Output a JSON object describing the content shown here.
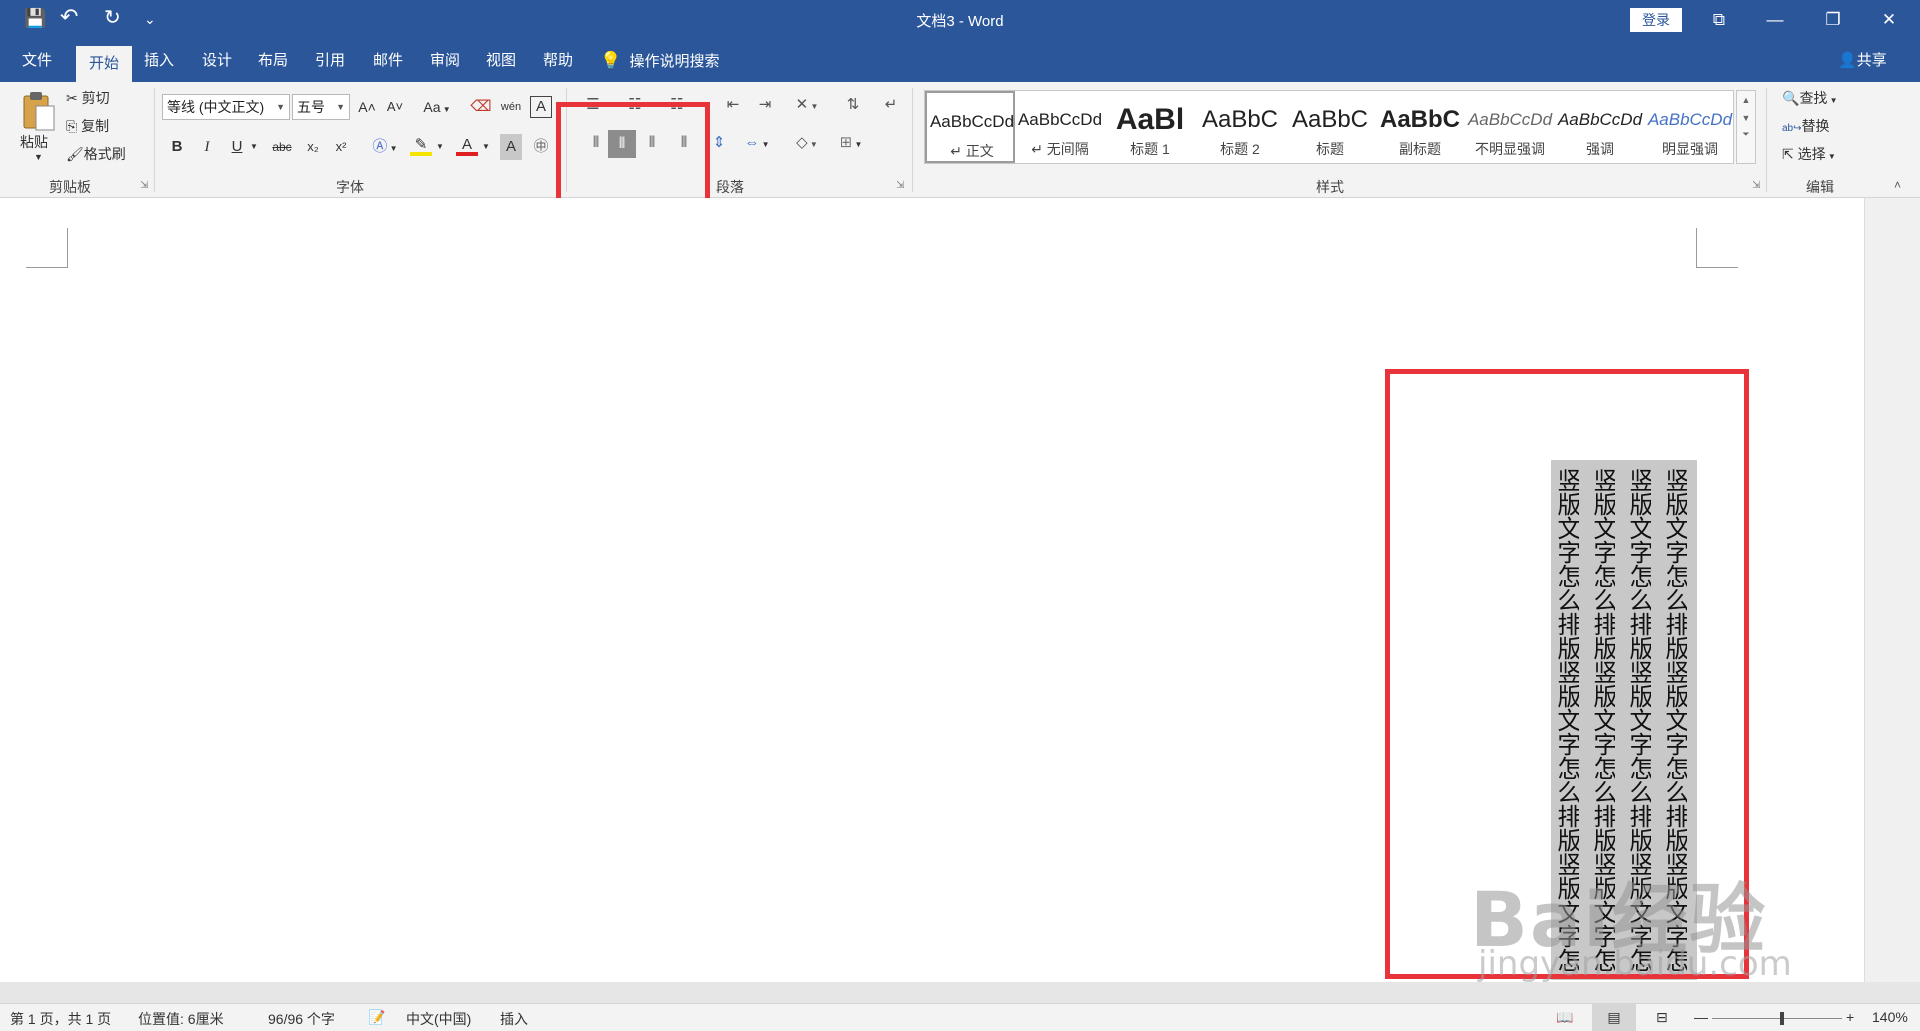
{
  "window": {
    "title": "文档3  -  Word",
    "login_label": "登录",
    "qa_save": "💾",
    "qa_undo": "↶",
    "qa_redo": "↻",
    "qa_more": "⌄",
    "btn_ribbon": "⧉",
    "btn_min": "—",
    "btn_max": "❐",
    "btn_close": "✕"
  },
  "tabs": [
    {
      "label": "文件"
    },
    {
      "label": "开始"
    },
    {
      "label": "插入"
    },
    {
      "label": "设计"
    },
    {
      "label": "布局"
    },
    {
      "label": "引用"
    },
    {
      "label": "邮件"
    },
    {
      "label": "审阅"
    },
    {
      "label": "视图"
    },
    {
      "label": "帮助"
    }
  ],
  "tellme": "操作说明搜索",
  "share": "共享",
  "clipboard": {
    "label": "剪贴板",
    "paste": "粘贴",
    "cut": "剪切",
    "copy": "复制",
    "format_painter": "格式刷"
  },
  "font": {
    "label": "字体",
    "font_name": "等线 (中文正文)",
    "font_size": "五号",
    "bold": "B",
    "italic": "I",
    "underline": "U",
    "strike": "abc",
    "subscript": "x₂",
    "superscript": "x²",
    "grow": "A˄",
    "shrink": "A˅",
    "case": "Aa",
    "color_a": "A",
    "wen": "wén",
    "border_a": "A"
  },
  "paragraph": {
    "label": "段落"
  },
  "styles": {
    "label": "样式",
    "items": [
      {
        "sample": "AaBbCcDd",
        "name": "↵ 正文"
      },
      {
        "sample": "AaBbCcDd",
        "name": "↵ 无间隔"
      },
      {
        "sample": "AaBl",
        "name": "标题 1"
      },
      {
        "sample": "AaBbC",
        "name": "标题 2"
      },
      {
        "sample": "AaBbC",
        "name": "标题"
      },
      {
        "sample": "AaBbC",
        "name": "副标题"
      },
      {
        "sample": "AaBbCcDd",
        "name": "不明显强调"
      },
      {
        "sample": "AaBbCcDd",
        "name": "强调"
      },
      {
        "sample": "AaBbCcDd",
        "name": "明显强调"
      }
    ]
  },
  "editing": {
    "label": "编辑",
    "find": "查找",
    "replace": "替换",
    "select": "选择"
  },
  "document": {
    "columns": [
      "竖版文字怎么排版竖版文字怎么排版竖版文字怎",
      "竖版文字怎么排版竖版文字怎么排版竖版文字怎",
      "竖版文字怎么排版竖版文字怎么排版竖版文字怎",
      "竖版文字怎么排版竖版文字怎么排版竖版文字怎"
    ]
  },
  "watermark": {
    "main": "Bai经验",
    "sub": "jingyan.baidu.com"
  },
  "status": {
    "page": "第 1 页，共 1 页",
    "position": "位置值: 6厘米",
    "words": "96/96 个字",
    "language": "中文(中国)",
    "mode": "插入",
    "zoom": "140%",
    "zoom_minus": "—",
    "zoom_plus": "+"
  }
}
